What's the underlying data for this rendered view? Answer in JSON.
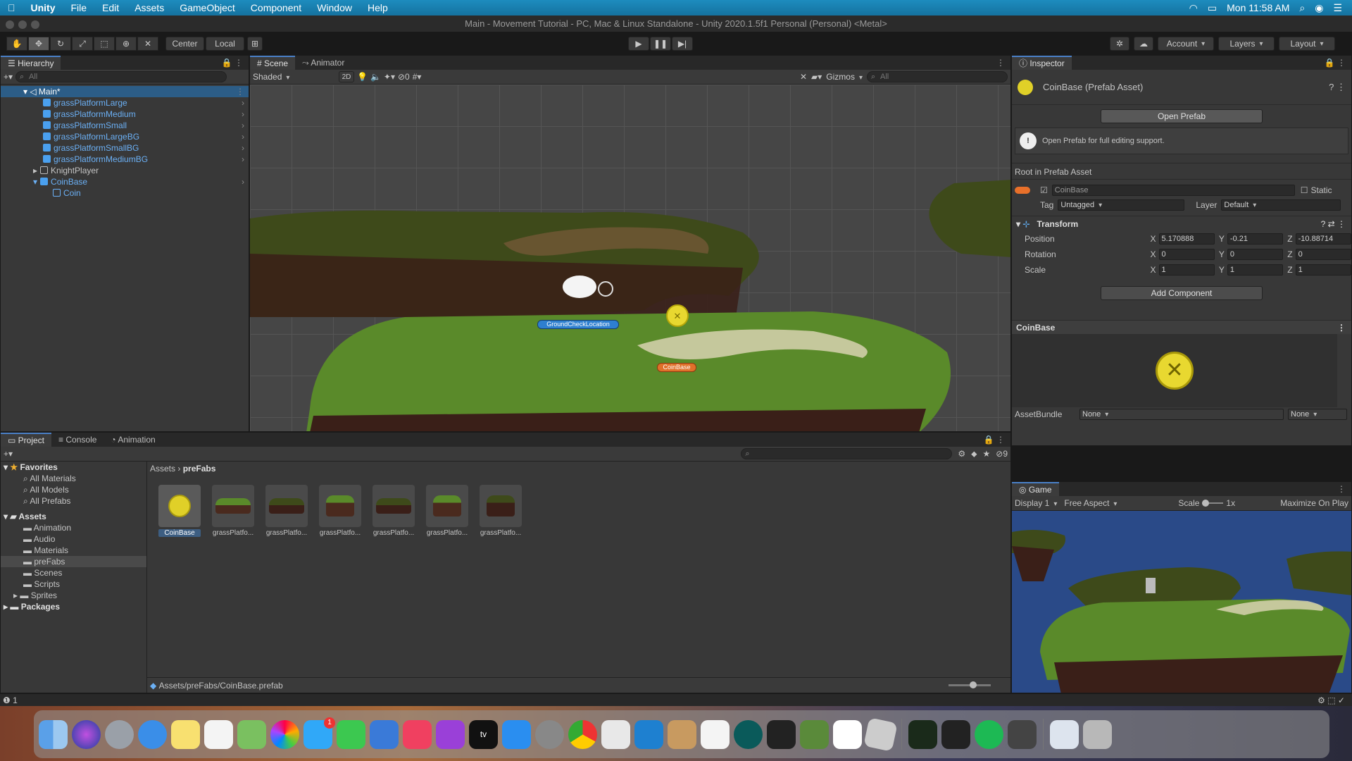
{
  "menubar": {
    "app": "Unity",
    "items": [
      "File",
      "Edit",
      "Assets",
      "GameObject",
      "Component",
      "Window",
      "Help"
    ],
    "clock": "Mon 11:58 AM"
  },
  "window": {
    "title": "Main - Movement Tutorial - PC, Mac & Linux Standalone - Unity 2020.1.5f1 Personal (Personal) <Metal>"
  },
  "toolbar": {
    "pivot": "Center",
    "space": "Local",
    "account": "Account",
    "layers": "Layers",
    "layout": "Layout"
  },
  "hierarchy": {
    "tab": "Hierarchy",
    "search_placeholder": "All",
    "scene": "Main*",
    "items": [
      {
        "label": "grassPlatformLarge"
      },
      {
        "label": "grassPlatformMedium"
      },
      {
        "label": "grassPlatformSmall"
      },
      {
        "label": "grassPlatformLargeBG"
      },
      {
        "label": "grassPlatformSmallBG"
      },
      {
        "label": "grassPlatformMediumBG"
      },
      {
        "label": "KnightPlayer"
      },
      {
        "label": "CoinBase"
      },
      {
        "label": "Coin"
      }
    ]
  },
  "scene": {
    "tabs": [
      "Scene",
      "Animator"
    ],
    "shading": "Shaded",
    "mode2d": "2D",
    "hidden_count": "0",
    "gizmos": "Gizmos",
    "search_placeholder": "All",
    "label_ground": "GroundCheckLocation",
    "label_coin": "CoinBase"
  },
  "project": {
    "tabs": [
      "Project",
      "Console",
      "Animation"
    ],
    "badge": "9",
    "favorites_title": "Favorites",
    "favorites": [
      "All Materials",
      "All Models",
      "All Prefabs"
    ],
    "assets_title": "Assets",
    "folders": [
      "Animation",
      "Audio",
      "Materials",
      "preFabs",
      "Scenes",
      "Scripts",
      "Sprites"
    ],
    "packages": "Packages",
    "breadcrumb_root": "Assets",
    "breadcrumb_leaf": "preFabs",
    "assets": [
      "CoinBase",
      "grassPlatfo...",
      "grassPlatfo...",
      "grassPlatfo...",
      "grassPlatfo...",
      "grassPlatfo...",
      "grassPlatfo..."
    ],
    "path": "Assets/preFabs/CoinBase.prefab"
  },
  "inspector": {
    "tab": "Inspector",
    "header": "CoinBase (Prefab Asset)",
    "open_prefab": "Open Prefab",
    "info": "Open Prefab for full editing support.",
    "root_label": "Root in Prefab Asset",
    "name": "CoinBase",
    "static": "Static",
    "tag_label": "Tag",
    "tag": "Untagged",
    "layer_label": "Layer",
    "layer": "Default",
    "transform": "Transform",
    "position": {
      "label": "Position",
      "x": "5.170888",
      "y": "-0.21",
      "z": "-10.88714"
    },
    "rotation": {
      "label": "Rotation",
      "x": "0",
      "y": "0",
      "z": "0"
    },
    "scale": {
      "label": "Scale",
      "x": "1",
      "y": "1",
      "z": "1"
    },
    "add_component": "Add Component",
    "preview_title": "CoinBase",
    "assetbundle_label": "AssetBundle",
    "assetbundle": "None",
    "assetbundle_variant": "None"
  },
  "game": {
    "tab": "Game",
    "display": "Display 1",
    "aspect": "Free Aspect",
    "scale_label": "Scale",
    "scale_value": "1x",
    "maximize": "Maximize On Play"
  },
  "statusbar": {
    "count": "1"
  },
  "dock": {
    "icons": [
      "finder-icon",
      "siri-icon",
      "launchpad-icon",
      "safari-icon",
      "notes-icon",
      "reminders-icon",
      "maps-icon",
      "photos-icon",
      "messages-icon",
      "facetime-icon",
      "keynote-icon",
      "music-icon",
      "podcasts-icon",
      "tv-icon",
      "appstore-icon",
      "system-preferences-icon",
      "chrome-icon",
      "preview-icon",
      "vscode-icon",
      "paintbrush-icon",
      "unity-icon",
      "gitkraken-icon",
      "unity-hub-icon",
      "minecraft-icon",
      "bankid-icon",
      "roblox-icon",
      "activity-monitor-icon",
      "terminal-icon",
      "spotify-icon",
      "sublime-icon",
      "documents-icon",
      "trash-icon"
    ],
    "messages_badge": "1",
    "tv_label": "tv"
  }
}
